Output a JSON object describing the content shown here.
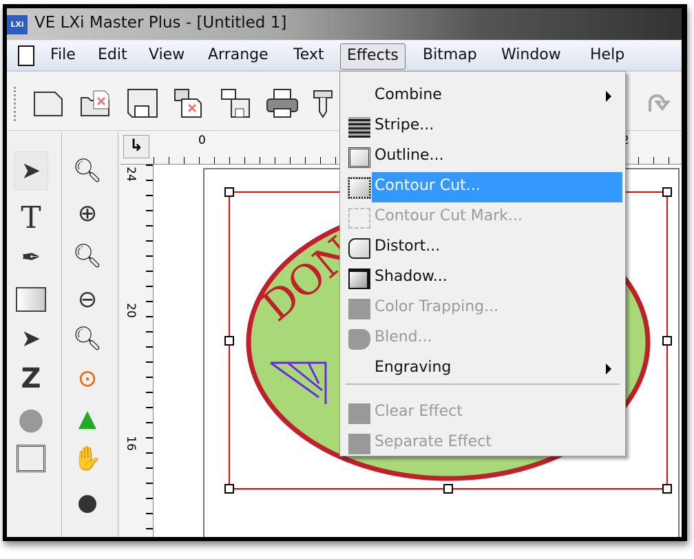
{
  "window": {
    "title": "VE LXi Master Plus - [Untitled 1]",
    "logo": "LXi"
  },
  "menubar": {
    "items": [
      {
        "label": "File"
      },
      {
        "label": "Edit"
      },
      {
        "label": "View"
      },
      {
        "label": "Arrange"
      },
      {
        "label": "Text"
      },
      {
        "label": "Effects",
        "active": true
      },
      {
        "label": "Bitmap"
      },
      {
        "label": "Window"
      },
      {
        "label": "Help"
      }
    ]
  },
  "toolbar": {
    "icons": [
      "new-icon",
      "open-icon",
      "save-icon",
      "import-icon",
      "export-icon",
      "print-icon",
      "cut-plotter-icon",
      "redo-icon"
    ]
  },
  "tools": {
    "column1": [
      "select-arrow-icon",
      "text-icon",
      "pen-icon",
      "rectangle-icon",
      "node-edit-icon",
      "zigzag-icon",
      "shape-icon",
      "frame-icon",
      "fill-icon"
    ],
    "column2": [
      "zoom-area-icon",
      "zoom-in-icon",
      "zoom-page-icon",
      "zoom-out-icon",
      "zoom-previous-icon",
      "zoom-selection-icon",
      "zoom-objects-icon",
      "pan-hand-icon",
      "color-icon"
    ]
  },
  "rulers": {
    "horizontal": [
      "0",
      "2"
    ],
    "vertical": [
      "24",
      "20",
      "16"
    ]
  },
  "effects_menu": {
    "items": [
      {
        "label": "Combine",
        "submenu": true,
        "enabled": true
      },
      {
        "label": "Stripe...",
        "enabled": true
      },
      {
        "label": "Outline...",
        "enabled": true
      },
      {
        "label": "Contour Cut...",
        "enabled": true,
        "highlighted": true
      },
      {
        "label": "Contour Cut Mark...",
        "enabled": false
      },
      {
        "label": "Distort...",
        "enabled": true
      },
      {
        "label": "Shadow...",
        "enabled": true
      },
      {
        "label": "Color Trapping...",
        "enabled": false
      },
      {
        "label": "Blend...",
        "enabled": false
      },
      {
        "label": "Engraving",
        "submenu": true,
        "enabled": true
      },
      {
        "label": "Clear Effect",
        "enabled": false
      },
      {
        "label": "Separate Effect",
        "enabled": false
      }
    ]
  },
  "colors": {
    "highlight": "#3399ff",
    "selection": "#ff0000",
    "badge_fill": "#a8d878",
    "badge_border": "#c0202a",
    "ornament": "#6a2be0"
  }
}
